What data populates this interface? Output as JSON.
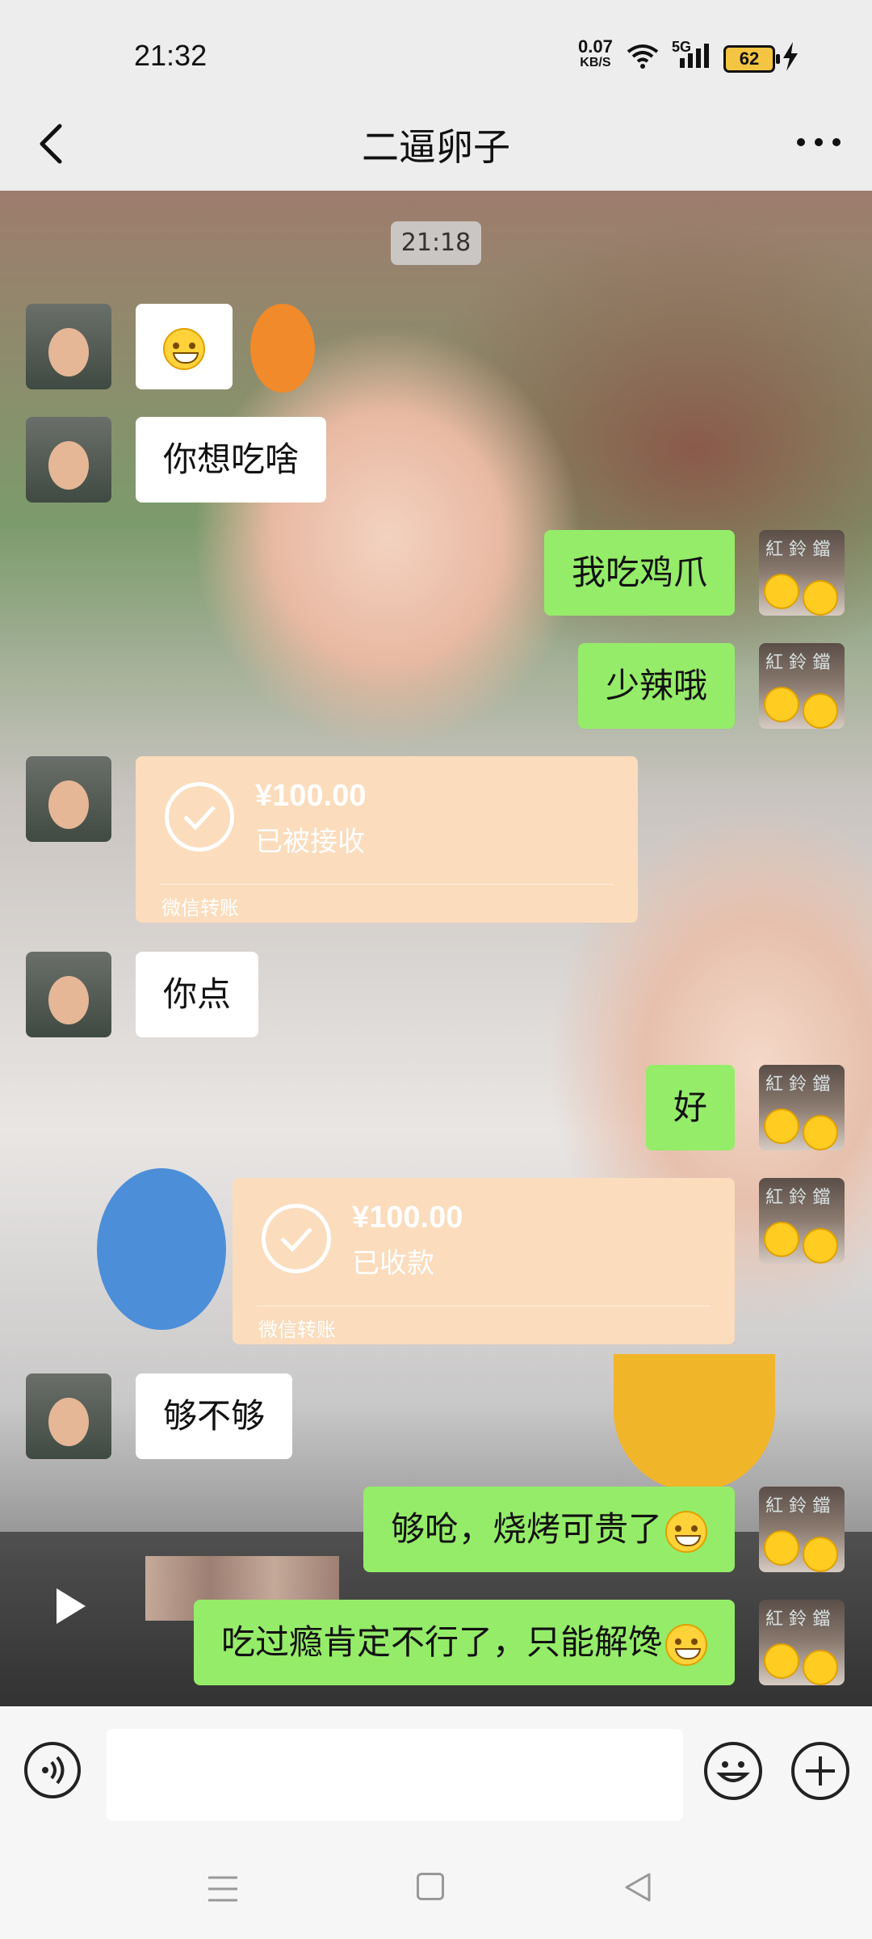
{
  "status_bar": {
    "time": "21:32",
    "net_speed": "0.07",
    "net_unit": "KB/S",
    "network_type": "5G",
    "battery": "62"
  },
  "header": {
    "title": "二逼卵子",
    "back_icon": "chevron-left-icon",
    "more_icon": "more-dots-icon"
  },
  "chat": {
    "timestamp": "21:18",
    "messages": [
      {
        "side": "left",
        "type": "emoji",
        "emoji": "grin-squint-emoji"
      },
      {
        "side": "left",
        "type": "text",
        "text": "你想吃啥"
      },
      {
        "side": "right",
        "type": "text",
        "text": "我吃鸡爪"
      },
      {
        "side": "right",
        "type": "text",
        "text": "少辣哦"
      },
      {
        "side": "left",
        "type": "transfer",
        "amount": "¥100.00",
        "status": "已被接收",
        "brand": "微信转账"
      },
      {
        "side": "left",
        "type": "text",
        "text": "你点"
      },
      {
        "side": "right",
        "type": "text",
        "text": "好"
      },
      {
        "side": "right",
        "type": "transfer",
        "amount": "¥100.00",
        "status": "已收款",
        "brand": "微信转账"
      },
      {
        "side": "left",
        "type": "text",
        "text": "够不够"
      },
      {
        "side": "right",
        "type": "text",
        "text": "够呛，烧烤可贵了",
        "emoji": "grin-emoji"
      },
      {
        "side": "right",
        "type": "text",
        "text": "吃过瘾肯定不行了，只能解馋",
        "emoji": "grin-emoji"
      }
    ]
  },
  "input_bar": {
    "voice_icon": "voice-icon",
    "emoji_icon": "emoji-icon",
    "plus_icon": "plus-icon",
    "placeholder": ""
  },
  "system_nav": {
    "menu_icon": "menu-icon",
    "home_icon": "home-icon",
    "back_icon": "back-triangle-icon"
  },
  "colors": {
    "bubble_right": "#95ec69",
    "bubble_left": "#ffffff",
    "transfer": "#fbdcbc",
    "header_bg": "#ededed"
  }
}
